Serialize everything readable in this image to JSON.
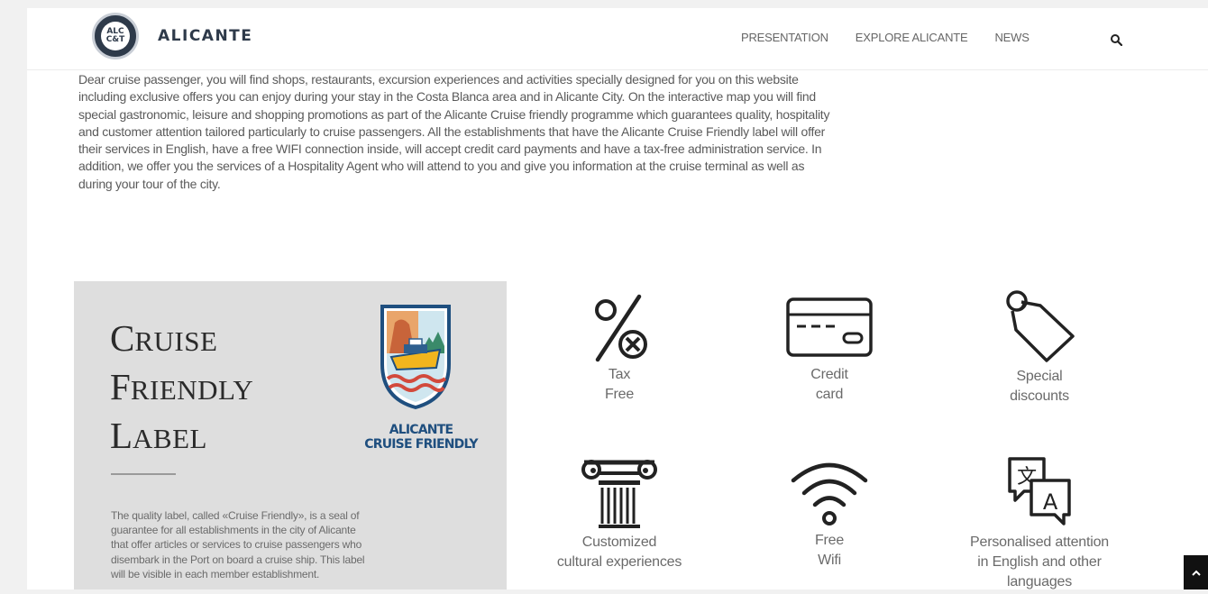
{
  "header": {
    "logo_mark": "ALC C&T",
    "brand": "ALICANTE",
    "nav": [
      "PRESENTATION",
      "EXPLORE ALICANTE",
      "NEWS"
    ],
    "search_icon": "search-icon"
  },
  "intro": {
    "lines": [
      "Dear cruise passenger, you will find shops, restaurants, excursion experiences and activities specially designed for you on this website",
      "including exclusive offers you can enjoy during your stay in the Costa Blanca area and in Alicante City. On the interactive map you will find",
      "special gastronomic, leisure and shopping promotions as part of the Alicante Cruise friendly programme which guarantees quality, hospitality",
      "and customer attention tailored particularly to cruise passengers.  All the establishments that have the Alicante Cruise Friendly label will offer",
      "their services in English, have a free WIFI connection inside, will accept credit card payments and have a tax-free administration service. In",
      "addition, we offer you the services of a Hospitality Agent who will attend to you and give you information at the cruise terminal as well as",
      "during your tour of the city."
    ]
  },
  "card": {
    "title": [
      {
        "cap": "C",
        "rest": "RUISE"
      },
      {
        "cap": "F",
        "rest": "RIENDLY"
      },
      {
        "cap": "L",
        "rest": "ABEL"
      }
    ],
    "badge_caption": [
      "ALICANTE",
      "CRUISE FRIENDLY"
    ],
    "text_lines": [
      "The quality label, called «Cruise Friendly», is a seal of",
      "guarantee for all establishments in the city of Alicante",
      "that offer articles or services to cruise passengers who",
      "disembark in the Port on board a cruise ship. This label",
      "will be visible in each member establishment."
    ]
  },
  "features": [
    {
      "icon": "percent-icon",
      "label": [
        "Tax",
        "Free"
      ]
    },
    {
      "icon": "credit-card-icon",
      "label": [
        "Credit",
        "card"
      ]
    },
    {
      "icon": "tag-icon",
      "label": [
        "Special",
        "discounts"
      ]
    },
    {
      "icon": "column-icon",
      "label": [
        "Customized",
        "cultural experiences"
      ]
    },
    {
      "icon": "wifi-icon",
      "label": [
        "Free",
        "Wifi"
      ]
    },
    {
      "icon": "translate-icon",
      "label": [
        "Personalised attention",
        "in English and other",
        "languages"
      ]
    }
  ],
  "colors": {
    "brand": "#2e3a4a",
    "badge_text": "#1f4f7f",
    "card_bg": "#dedede"
  }
}
